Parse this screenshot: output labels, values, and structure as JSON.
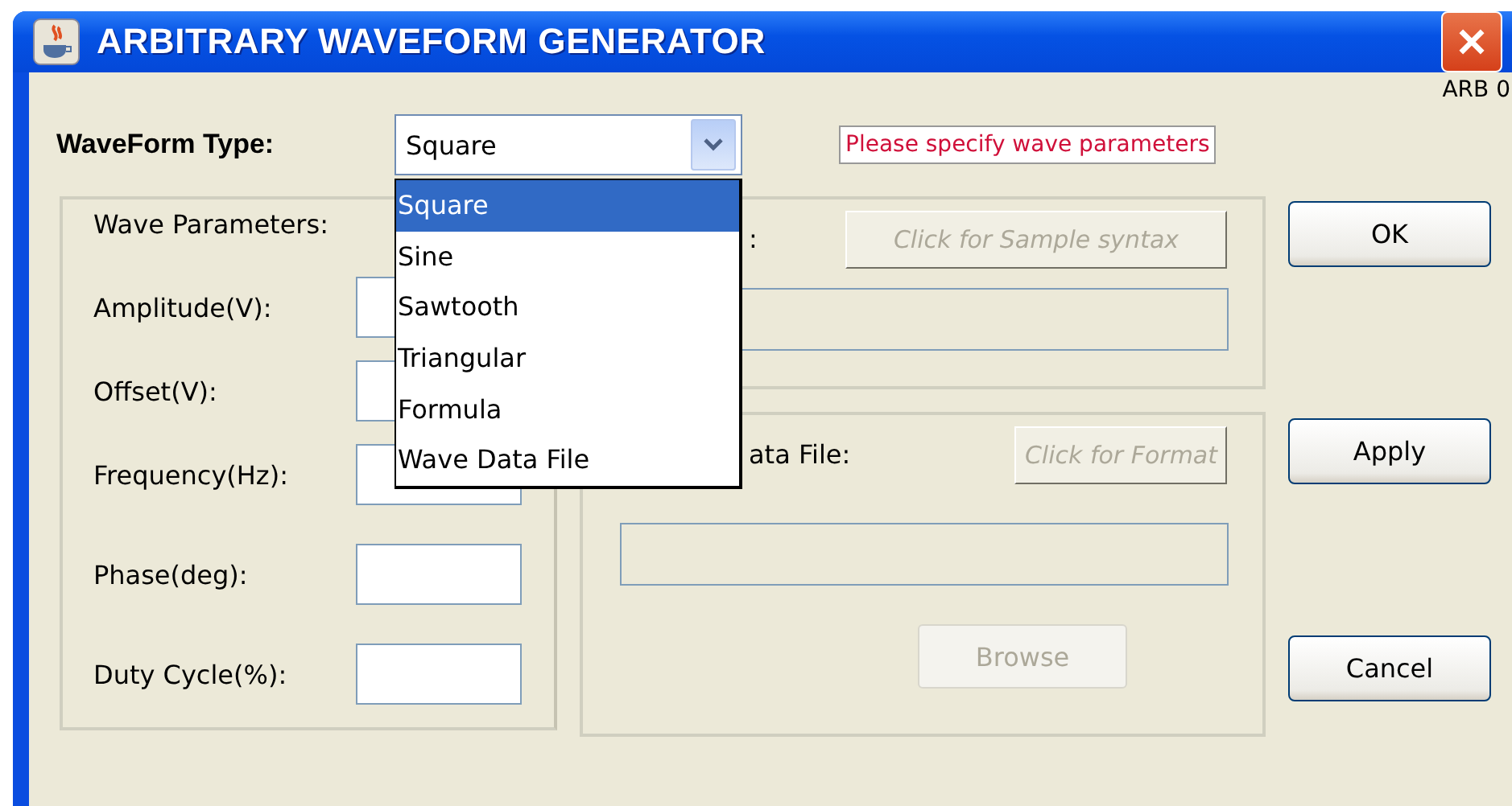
{
  "window": {
    "title": "ARBITRARY WAVEFORM GENERATOR",
    "corner_label": "ARB 0"
  },
  "waveform_type": {
    "label": "WaveForm Type:",
    "value": "Square",
    "expanded": true,
    "options": [
      {
        "label": "Square",
        "selected": true
      },
      {
        "label": "Sine",
        "selected": false
      },
      {
        "label": "Sawtooth",
        "selected": false
      },
      {
        "label": "Triangular",
        "selected": false
      },
      {
        "label": "Formula",
        "selected": false
      },
      {
        "label": "Wave Data File",
        "selected": false
      }
    ]
  },
  "message": "Please specify wave parameters",
  "wave_parameters": {
    "title": "Wave Parameters:",
    "fields": [
      {
        "label": "Amplitude(V):"
      },
      {
        "label": "Offset(V):"
      },
      {
        "label": "Frequency(Hz):"
      },
      {
        "label": "Phase(deg):"
      },
      {
        "label": "Duty Cycle(%):"
      }
    ]
  },
  "formula_panel": {
    "label": ":",
    "button": {
      "label": "Click for Sample syntax",
      "disabled": true
    }
  },
  "file_panel": {
    "label": "ata File:",
    "button": {
      "label": "Click for Format",
      "disabled": true
    },
    "browse": {
      "label": "Browse",
      "disabled": true
    }
  },
  "buttons": [
    "OK",
    "Apply",
    "Cancel"
  ]
}
